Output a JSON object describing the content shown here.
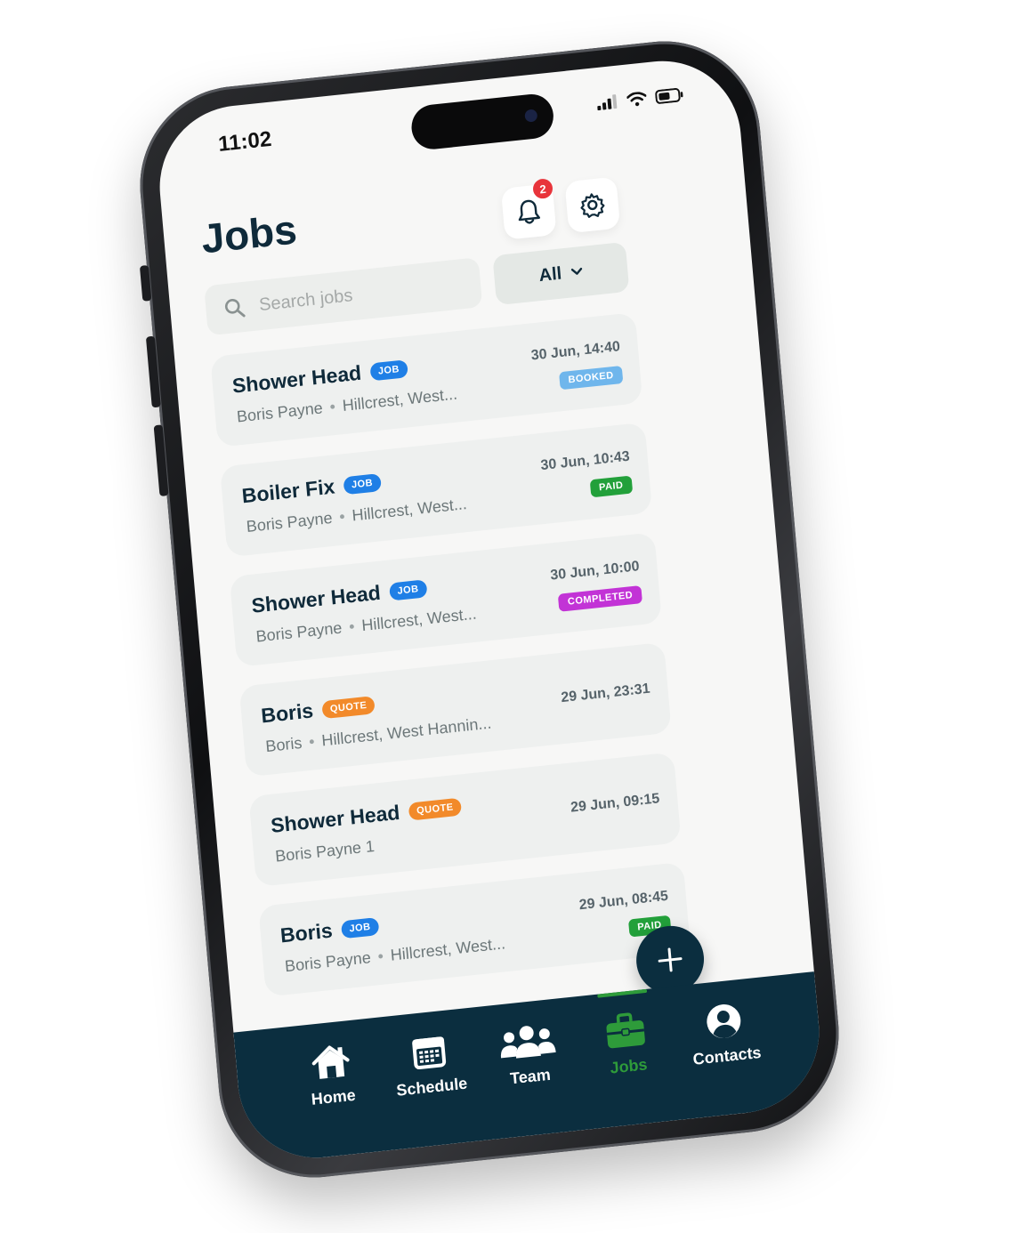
{
  "status_bar": {
    "time": "11:02"
  },
  "header": {
    "title": "Jobs",
    "notification_count": "2"
  },
  "search": {
    "placeholder": "Search jobs"
  },
  "filter": {
    "label": "All"
  },
  "jobs": [
    {
      "title": "Shower Head",
      "type": "JOB",
      "client": "Boris Payne",
      "location": "Hillcrest, West...",
      "date": "30 Jun, 14:40",
      "status": "BOOKED"
    },
    {
      "title": "Boiler Fix",
      "type": "JOB",
      "client": "Boris Payne",
      "location": "Hillcrest, West...",
      "date": "30 Jun, 10:43",
      "status": "PAID"
    },
    {
      "title": "Shower Head",
      "type": "JOB",
      "client": "Boris Payne",
      "location": "Hillcrest, West...",
      "date": "30 Jun, 10:00",
      "status": "COMPLETED"
    },
    {
      "title": "Boris",
      "type": "QUOTE",
      "client": "Boris",
      "location": "Hillcrest, West Hannin...",
      "date": "29 Jun, 23:31",
      "status": ""
    },
    {
      "title": "Shower Head",
      "type": "QUOTE",
      "client": "Boris Payne 1",
      "location": "",
      "date": "29 Jun, 09:15",
      "status": ""
    },
    {
      "title": "Boris",
      "type": "JOB",
      "client": "Boris Payne",
      "location": "Hillcrest, West...",
      "date": "29 Jun, 08:45",
      "status": "PAID"
    }
  ],
  "nav": {
    "items": [
      {
        "label": "Home",
        "icon": "home-icon"
      },
      {
        "label": "Schedule",
        "icon": "calendar-icon"
      },
      {
        "label": "Team",
        "icon": "team-icon"
      },
      {
        "label": "Jobs",
        "icon": "briefcase-icon",
        "active": true
      },
      {
        "label": "Contacts",
        "icon": "user-circle-icon"
      }
    ]
  },
  "colors": {
    "navy": "#0b2e3f",
    "job_badge": "#1f7fe6",
    "quote_badge": "#f28a2a",
    "booked": "#6fb6ec",
    "paid": "#22a03a",
    "completed": "#c233d6",
    "active_nav": "#2e9b3a"
  }
}
